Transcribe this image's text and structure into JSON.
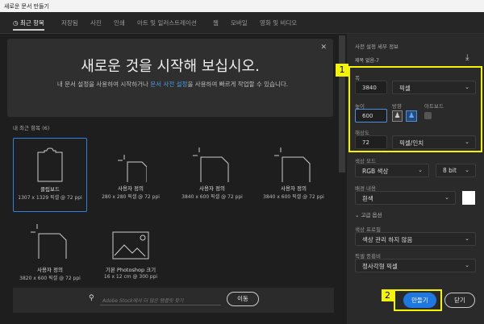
{
  "window": {
    "title": "새로운 문서 만들기"
  },
  "tabs": [
    "최근 항목",
    "저장됨",
    "사진",
    "인쇄",
    "아트 및 일러스트레이션",
    "웹",
    "모바일",
    "영화 및 비디오"
  ],
  "banner": {
    "title": "새로운 것을 시작해 보십시오.",
    "text_before": "내 문서 설정을 사용하여 시작하거나 ",
    "link": "문서 사전 설정",
    "text_after": "을 사용하여 빠르게 작업할 수 있습니다."
  },
  "recent": {
    "label": "내 최근 항목 (6)",
    "items": [
      {
        "name": "클립보드",
        "size": "1307 x 1329 픽셀 @ 72 ppi",
        "icon": "clipboard-icon"
      },
      {
        "name": "사용자 정의",
        "size": "280 x 280 픽셀 @ 72 ppi",
        "icon": "custom-doc-icon"
      },
      {
        "name": "사용자 정의",
        "size": "3840 x 600 픽셀 @ 72 ppi",
        "icon": "custom-doc-icon"
      },
      {
        "name": "사용자 정의",
        "size": "3840 x 600 픽셀 @ 72 ppi",
        "icon": "custom-doc-icon"
      },
      {
        "name": "사용자 정의",
        "size": "3820 x 600 픽셀 @ 72 ppi",
        "icon": "custom-doc-icon"
      },
      {
        "name": "기본 Photoshop 크기",
        "size": "16 x 12 cm @ 300 ppi",
        "icon": "image-icon"
      }
    ]
  },
  "search": {
    "placeholder": "Adobe Stock에서 더 많은 템플릿 찾기",
    "go": "이동"
  },
  "preset": {
    "header": "사전 설정 세부 정보",
    "doc_name": "제목 없음-7",
    "width_label": "폭",
    "width": "3840",
    "width_unit": "픽셀",
    "height_label": "높이",
    "height": "600",
    "orientation_label": "방향",
    "artboard_label": "아트보드",
    "resolution_label": "해상도",
    "resolution": "72",
    "resolution_unit": "픽셀/인치",
    "color_mode_label": "색상 모드",
    "color_mode": "RGB 색상",
    "bit_depth": "8 bit",
    "bg_label": "배경 내용",
    "bg": "흰색",
    "bg_color": "#ffffff",
    "advanced": "고급 옵션",
    "profile_label": "색상 프로필",
    "profile": "색상 관리 하지 않음",
    "pixel_ratio_label": "픽셀 종횡비",
    "pixel_ratio": "정사각형 픽셀"
  },
  "buttons": {
    "create": "만들기",
    "close": "닫기"
  },
  "annotations": [
    "1",
    "2"
  ],
  "colors": {
    "accent": "#2f80e0",
    "highlight": "#f5f500"
  }
}
